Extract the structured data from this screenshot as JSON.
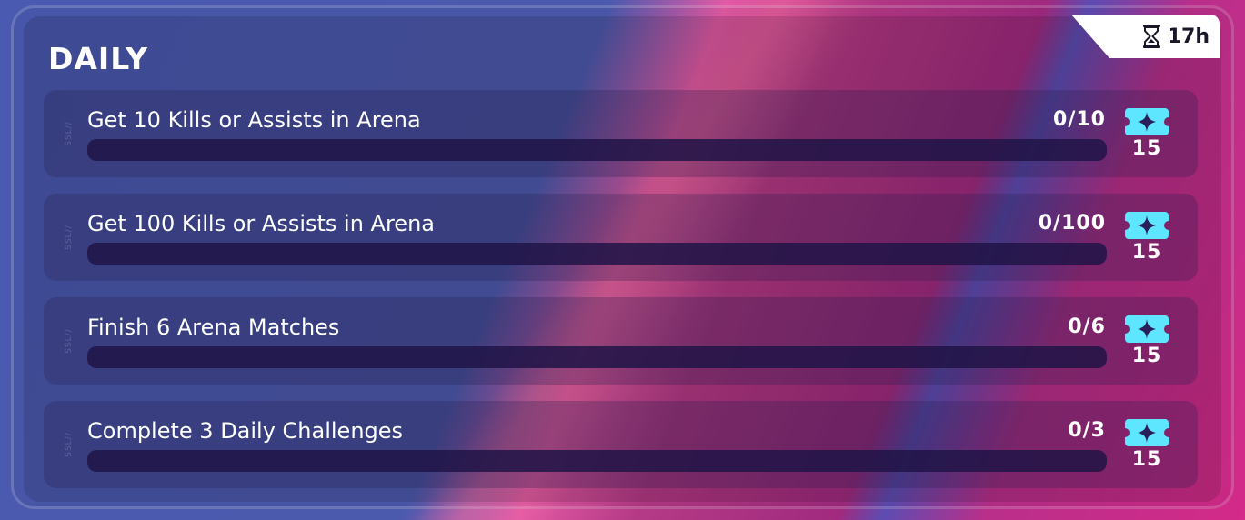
{
  "panel": {
    "title": "DAILY",
    "timer": {
      "icon": "hourglass-icon",
      "text": "17h"
    }
  },
  "colors": {
    "accent": "#5ee5ff",
    "bar_track": "#20144a",
    "timer_bg": "#ffffff",
    "timer_text": "#18182a"
  },
  "quests": [
    {
      "label": "Get 10 Kills or Assists in Arena",
      "progress": "0/10",
      "fraction": 0,
      "reward_icon": "ticket-icon",
      "reward": "15"
    },
    {
      "label": "Get 100 Kills or Assists in Arena",
      "progress": "0/100",
      "fraction": 0,
      "reward_icon": "ticket-icon",
      "reward": "15"
    },
    {
      "label": "Finish 6 Arena Matches",
      "progress": "0/6",
      "fraction": 0,
      "reward_icon": "ticket-icon",
      "reward": "15"
    },
    {
      "label": "Complete 3 Daily Challenges",
      "progress": "0/3",
      "fraction": 0,
      "reward_icon": "ticket-icon",
      "reward": "15"
    }
  ]
}
